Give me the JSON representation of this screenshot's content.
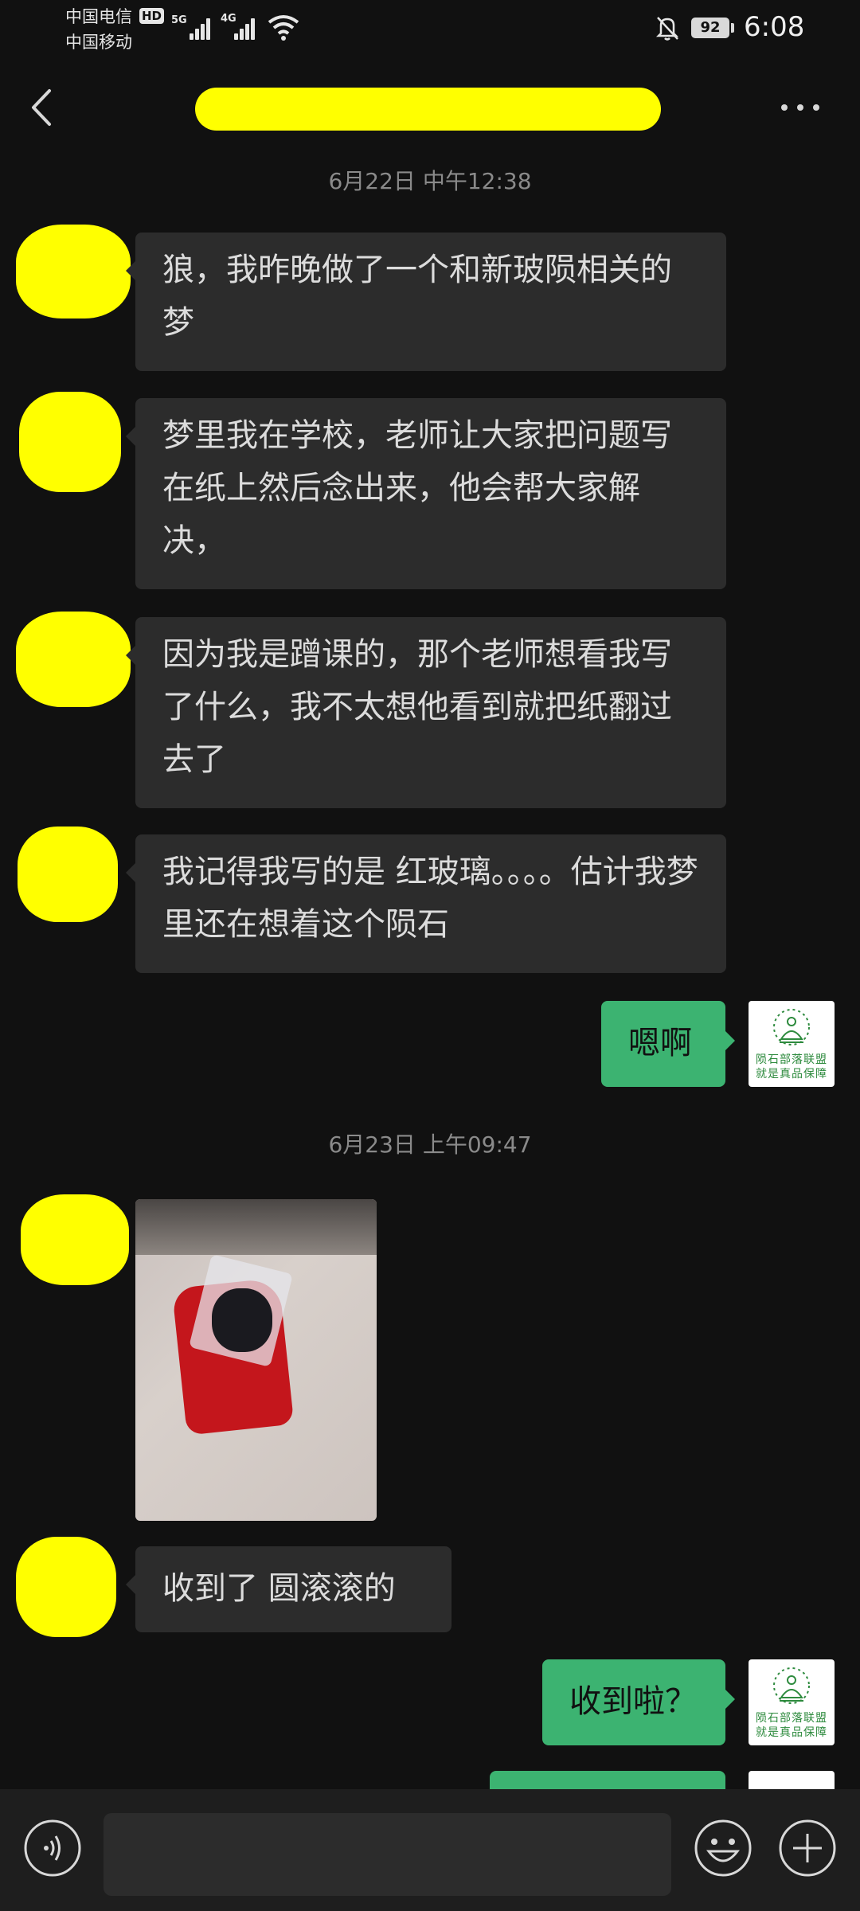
{
  "status_bar": {
    "carrier_1": "中国电信",
    "hd_badge": "HD",
    "carrier_2": "中国移动",
    "network_1": "5G",
    "network_2": "4G",
    "battery": "92",
    "time": "6:08",
    "icons": [
      "signal-icon",
      "wifi-icon",
      "bell-off-icon",
      "battery-icon"
    ]
  },
  "header": {
    "back_icon": "chevron-left-icon",
    "more_icon": "more-horizontal-icon"
  },
  "messages": [
    {
      "type": "timestamp",
      "text": "6月22日 中午12:38"
    },
    {
      "type": "incoming",
      "text": "狼，我昨晚做了一个和新玻陨相关的梦"
    },
    {
      "type": "incoming",
      "text": "梦里我在学校，老师让大家把问题写在纸上然后念出来，他会帮大家解决，"
    },
    {
      "type": "incoming",
      "text": "因为我是蹭课的，那个老师想看我写了什么，我不太想他看到就把纸翻过去了"
    },
    {
      "type": "incoming",
      "text": "我记得我写的是 红玻璃。。。。估计我梦里还在想着这个陨石"
    },
    {
      "type": "outgoing",
      "text": "嗯啊"
    },
    {
      "type": "timestamp",
      "text": "6月23日 上午09:47"
    },
    {
      "type": "incoming_image",
      "description": "photo"
    },
    {
      "type": "incoming",
      "text": "收到了 圆滚滚的"
    },
    {
      "type": "outgoing",
      "text": "收到啦？"
    }
  ],
  "my_avatar": {
    "line_1": "陨石部落联盟",
    "line_2": "就是真品保障"
  },
  "colors": {
    "background": "#111111",
    "incoming_bubble": "#2c2c2c",
    "outgoing_bubble": "#3cb371",
    "input_bar": "#1e1e1e",
    "redaction": "#ffff00"
  },
  "input_bar": {
    "voice_icon": "voice-icon",
    "emoji_icon": "emoji-icon",
    "plus_icon": "plus-circle-icon"
  }
}
